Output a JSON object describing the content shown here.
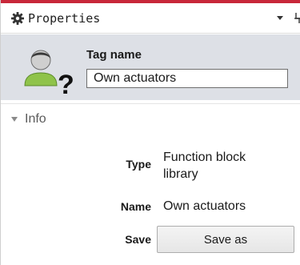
{
  "header": {
    "title": "Properties",
    "accent_color": "#c8283a"
  },
  "tag": {
    "label": "Tag name",
    "value": "Own actuators"
  },
  "info_section": {
    "title": "Info",
    "expanded": true,
    "type_label": "Type",
    "type_value": "Function block library",
    "name_label": "Name",
    "name_value": "Own actuators",
    "save_label": "Save",
    "save_button": "Save as"
  }
}
